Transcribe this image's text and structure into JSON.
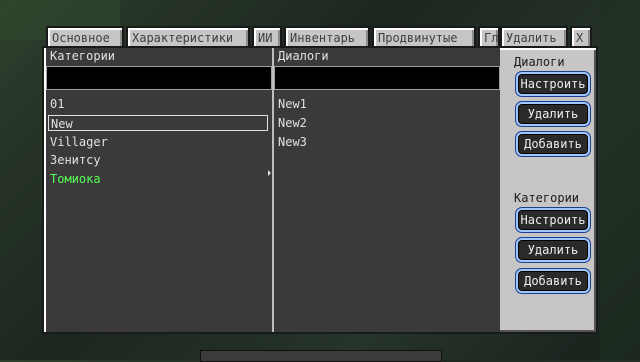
{
  "tabs": [
    {
      "label": "Основное"
    },
    {
      "label": "Характеристики"
    },
    {
      "label": "ИИ"
    },
    {
      "label": "Инвентарь"
    },
    {
      "label": "Продвинутые"
    },
    {
      "label": "Гл"
    },
    {
      "label": "Удалить"
    },
    {
      "label": "X"
    }
  ],
  "columns": {
    "categories_header": "Категории",
    "dialogs_header": "Диалоги"
  },
  "categories": [
    {
      "label": "01"
    },
    {
      "label": "New"
    },
    {
      "label": "Villager"
    },
    {
      "label": "Зенитсу"
    },
    {
      "label": "Томиока"
    }
  ],
  "dialogs": [
    {
      "label": "New1"
    },
    {
      "label": "New2"
    },
    {
      "label": "New3"
    }
  ],
  "dialogs_group": {
    "title": "Диалоги",
    "configure": "Настроить",
    "delete": "Удалить",
    "add": "Добавить"
  },
  "categories_group": {
    "title": "Категории",
    "configure": "Настроить",
    "delete": "Удалить",
    "add": "Добавить"
  },
  "colors": {
    "highlight_item": "#55ff55",
    "button_border": "#9fc8ff"
  }
}
